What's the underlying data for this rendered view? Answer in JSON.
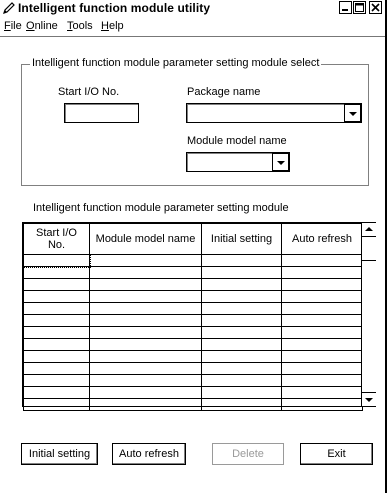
{
  "window": {
    "title": "Intelligent function module utility"
  },
  "menubar": {
    "items": [
      {
        "label": "File",
        "mnemonic": "F",
        "rest": "ile"
      },
      {
        "label": "Online",
        "mnemonic": "O",
        "rest": "nline"
      },
      {
        "label": "Tools",
        "mnemonic": "T",
        "rest": "ools"
      },
      {
        "label": "Help",
        "mnemonic": "H",
        "rest": "elp"
      }
    ]
  },
  "select_group": {
    "title": "Intelligent function module parameter setting module select",
    "start_io_label": "Start I/O No.",
    "start_io_value": "",
    "package_label": "Package name",
    "package_value": "",
    "model_label": "Module model name",
    "model_value": ""
  },
  "param_table": {
    "title": "Intelligent function module parameter setting module",
    "columns": [
      "Start I/O No.",
      "Module model name",
      "Initial setting",
      "Auto refresh"
    ],
    "column_lines": [
      [
        "Start I/O",
        "No."
      ],
      [
        "Module model name"
      ],
      [
        "Initial setting"
      ],
      [
        "Auto refresh"
      ]
    ],
    "row_count": 13,
    "rows": []
  },
  "buttons": {
    "initial_setting": "Initial setting",
    "auto_refresh": "Auto refresh",
    "delete": "Delete",
    "exit": "Exit"
  },
  "icons": {
    "app": "pen-icon",
    "minimize": "minimize-icon",
    "maximize": "maximize-icon",
    "close": "close-icon"
  }
}
